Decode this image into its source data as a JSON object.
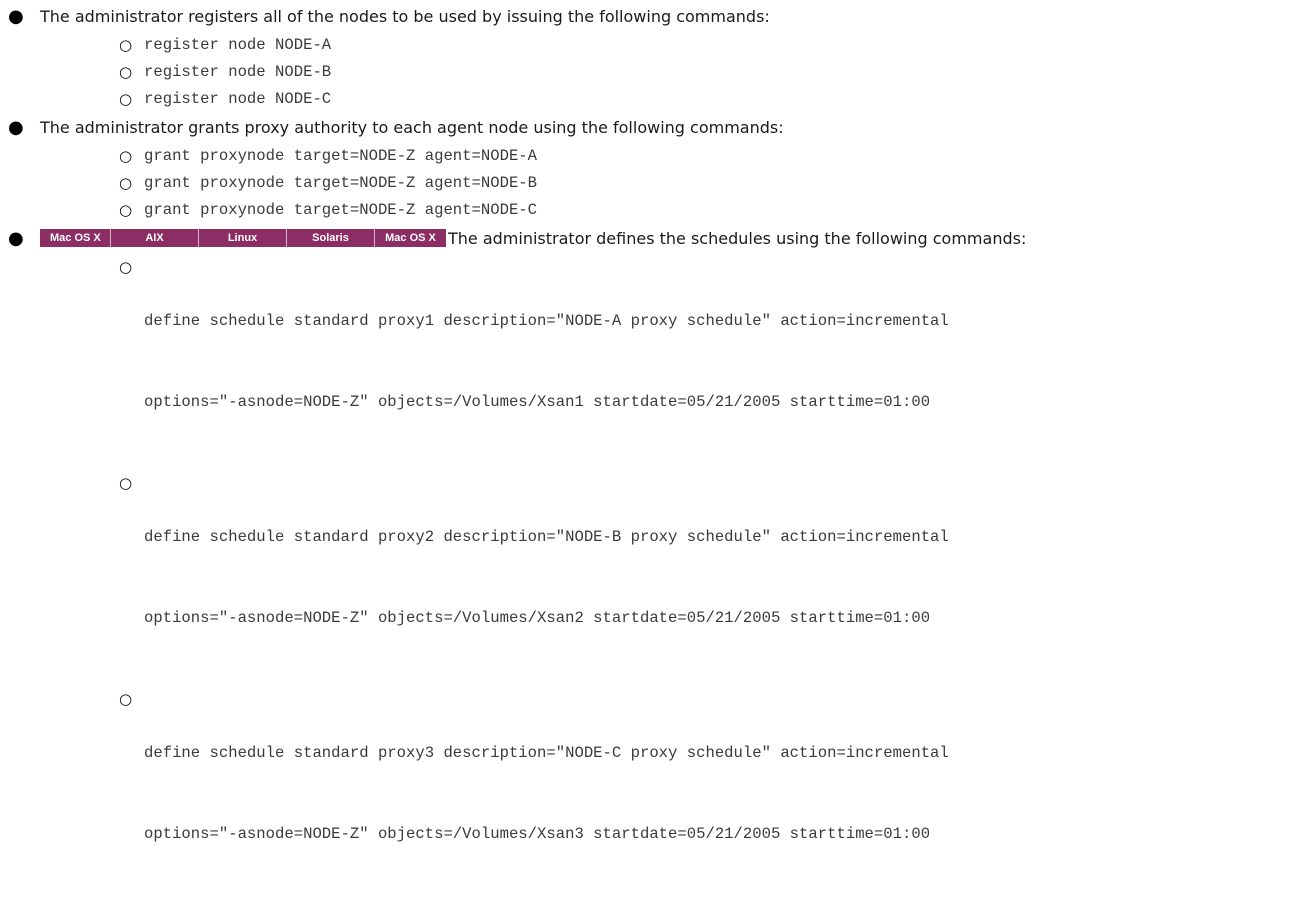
{
  "sections": [
    {
      "intro": "The administrator registers all of the nodes to be used by issuing the following commands:",
      "commands": [
        [
          "register node NODE-A"
        ],
        [
          "register node NODE-B"
        ],
        [
          "register node NODE-C"
        ]
      ]
    },
    {
      "intro": "The administrator grants proxy authority to each agent node using the following commands:",
      "commands": [
        [
          "grant proxynode target=NODE-Z agent=NODE-A"
        ],
        [
          "grant proxynode target=NODE-Z agent=NODE-B"
        ],
        [
          "grant proxynode target=NODE-Z agent=NODE-C"
        ]
      ]
    },
    {
      "badges": [
        "Mac OS X",
        "AIX",
        "Linux",
        "Solaris",
        "Mac OS X"
      ],
      "intro": "The administrator defines the schedules using the following commands:",
      "commands": [
        [
          "define schedule standard proxy1 description=\"NODE-A proxy schedule\" action=incremental",
          "options=\"-asnode=NODE-Z\" objects=/Volumes/Xsan1 startdate=05/21/2005 starttime=01:00"
        ],
        [
          "define schedule standard proxy2 description=\"NODE-B proxy schedule\" action=incremental",
          "options=\"-asnode=NODE-Z\" objects=/Volumes/Xsan2 startdate=05/21/2005 starttime=01:00"
        ],
        [
          "define schedule standard proxy3 description=\"NODE-C proxy schedule\" action=incremental",
          "options=\"-asnode=NODE-Z\" objects=/Volumes/Xsan3 startdate=05/21/2005 starttime=01:00"
        ]
      ]
    }
  ],
  "colors": {
    "badge_bg": "#8c2d63",
    "badge_text": "#ffffff",
    "code_text": "#3a3a3a"
  }
}
